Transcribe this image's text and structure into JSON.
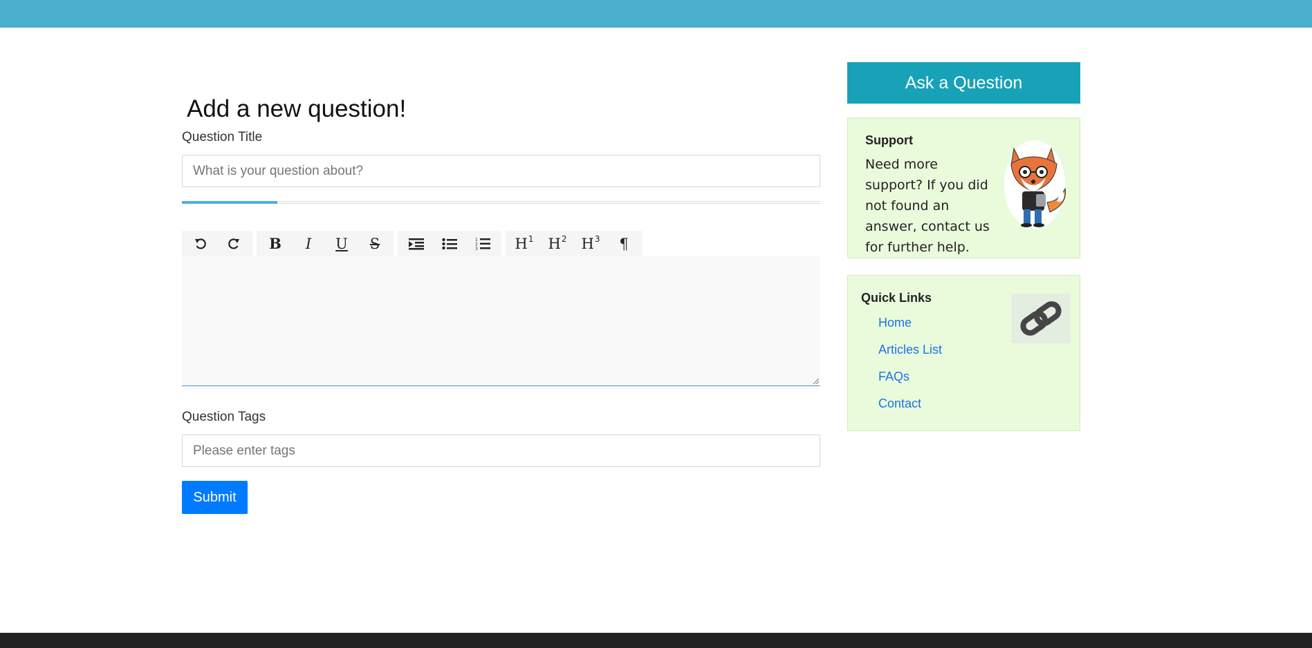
{
  "form": {
    "heading": "Add a new question!",
    "title_label": "Question Title",
    "title_placeholder": "What is your question about?",
    "title_value": "",
    "title_progress": 0.15,
    "tags_label": "Question Tags",
    "tags_placeholder": "Please enter tags",
    "tags_value": "",
    "editor_content": "",
    "submit_label": "Submit"
  },
  "editor_toolbar": {
    "groups": [
      [
        {
          "name": "undo",
          "icon": "undo-icon"
        },
        {
          "name": "redo",
          "icon": "redo-icon"
        }
      ],
      [
        {
          "name": "bold",
          "label": "B"
        },
        {
          "name": "italic",
          "label": "I"
        },
        {
          "name": "underline",
          "label": "U"
        },
        {
          "name": "strikethrough",
          "label": "S"
        }
      ],
      [
        {
          "name": "indent",
          "icon": "indent-icon"
        },
        {
          "name": "bullet-list",
          "icon": "bullet-list-icon"
        },
        {
          "name": "numbered-list",
          "icon": "numbered-list-icon"
        }
      ],
      [
        {
          "name": "heading-1",
          "label": "H",
          "sup": "1"
        },
        {
          "name": "heading-2",
          "label": "H",
          "sup": "2"
        },
        {
          "name": "heading-3",
          "label": "H",
          "sup": "3"
        },
        {
          "name": "paragraph",
          "label": "¶"
        }
      ]
    ]
  },
  "sidebar": {
    "ask_button_label": "Ask a Question",
    "support": {
      "title": "Support",
      "text": "Need more support? If you did not found an answer, contact us for further help.",
      "image_icon": "fox-mascot-icon"
    },
    "quick_links": {
      "title": "Quick Links",
      "icon": "link-chain-icon",
      "links": [
        "Home",
        "Articles List",
        "FAQs",
        "Contact"
      ]
    }
  },
  "colors": {
    "topbar": "#4aafcd",
    "ask_button": "#17a2b8",
    "submit_button": "#007bff",
    "card_background": "#eafbdc",
    "link": "#1a73e8",
    "footer": "#222222"
  }
}
